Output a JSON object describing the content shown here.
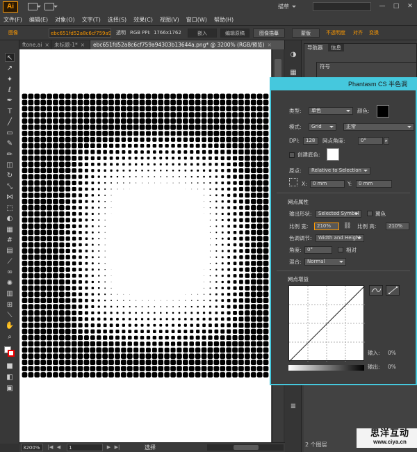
{
  "app": {
    "logo": "Ai",
    "workspace": "描草",
    "window_controls": [
      "—",
      "□",
      "✕"
    ]
  },
  "menus": [
    "文件(F)",
    "编辑(E)",
    "对象(O)",
    "文字(T)",
    "选择(S)",
    "效果(C)",
    "视图(V)",
    "窗口(W)",
    "帮助(H)"
  ],
  "controlbar": {
    "label": "图像",
    "filename": "ebc651fd52a8c6cf759a94...",
    "transparency": "透明",
    "color_mode": "RGB",
    "ppi_label": "PPI:",
    "ppi_value": "1766x1762",
    "embed": "嵌入",
    "edit_original": "编辑原稿",
    "image_trace": "图像描摹",
    "mask": "蒙版",
    "opacity": "不透明度",
    "align": "对齐",
    "transform": "变换"
  },
  "doctabs": [
    {
      "label": "ftone.ai",
      "close": "×"
    },
    {
      "label": "未标题-1*",
      "close": "×"
    },
    {
      "label": "ebc651fd52a8c6cf759a94303b13644a.png* @ 3200% (RGB/预览)",
      "close": "×"
    }
  ],
  "statusbar": {
    "zoom": "3200%",
    "page": "1",
    "status": "选择"
  },
  "right_panels": {
    "navigator_tab": "导航器",
    "info_tab": "信息",
    "symbol_tab": "符号",
    "count_text": "2 个图层"
  },
  "watermark": {
    "line1": "思洋互动",
    "line2": "www.ciya.cn"
  },
  "phantasm": {
    "title": "Phantasm CS 半色调",
    "type_label": "类型:",
    "type_value": "单色",
    "color_label": "颜色:",
    "color_value": "#000000",
    "mode_label": "模式:",
    "mode_value": "Grid",
    "blend_value": "正常",
    "dpi_label": "DPI:",
    "dpi_value": "128",
    "angle_label": "网点角度:",
    "angle_value": "0°",
    "create_bg_label": "创建底色:",
    "bg_color_value": "#ffffff",
    "origin_label": "原点:",
    "origin_value": "Relative to Selection",
    "x_label": "X:",
    "x_value": "0 mm",
    "y_label": "Y:",
    "y_value": "0 mm",
    "dot_attr_title": "网点属性",
    "shape_label": "输出形状:",
    "shape_value": "Selected Symbol",
    "invert_label": "翼色",
    "scale_w_label": "比例 宽:",
    "scale_w_value": "210%",
    "scale_h_label": "比例 高:",
    "scale_h_value": "210%",
    "color_adjust_label": "色调调节:",
    "color_adjust_value": "Width and Height",
    "angle2_label": "角度:",
    "angle2_value": "0°",
    "relative_label": "相对",
    "blend_label": "混合:",
    "blend2_value": "Normal",
    "dot_gain_title": "网点增益",
    "input_label": "输入:",
    "input_value": "0%",
    "output_label": "输出:",
    "output_value": "0%"
  },
  "colors": {
    "accent_orange": "#ff9a00",
    "dialog_border": "#45c8dd",
    "halftone_dot": "#000000"
  }
}
